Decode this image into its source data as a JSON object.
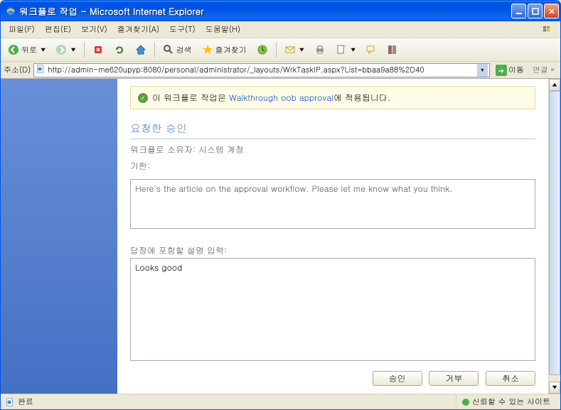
{
  "window": {
    "title": "워크플로 작업 - Microsoft Internet Explorer"
  },
  "menu": {
    "file": "파일(F)",
    "edit": "편집(E)",
    "view": "보기(V)",
    "favorites": "즐겨찾기(A)",
    "tools": "도구(T)",
    "help": "도움말(H)"
  },
  "toolbar": {
    "back": "뒤로",
    "search": "검색",
    "favorites": "즐겨찾기"
  },
  "address": {
    "label": "주소(D)",
    "url": "http://admin-me620upyp:8080/personal/administrator/_layouts/WrkTaskIP.aspx?List=bbaa9a88%2D40",
    "go": "이동",
    "links": "연결"
  },
  "page": {
    "notice_prefix": "이 워크플로 작업은 ",
    "notice_link": "Walkthrough oob approval",
    "notice_suffix": "에 적용됩니다.",
    "section_title": "요청한 승인",
    "owner_line": "워크플로 소유자: 시스템 계정",
    "due_line": "기한:",
    "readonly_text": "Here's the article on the approval workflow. Please let me know what you think.",
    "input_label": "답장에 포함할 설명 입력:",
    "input_value": "Looks good",
    "buttons": {
      "approve": "승인",
      "reject": "거부",
      "cancel": "취소"
    }
  },
  "status": {
    "text": "완료",
    "zone": "신뢰할 수 있는 사이트"
  }
}
